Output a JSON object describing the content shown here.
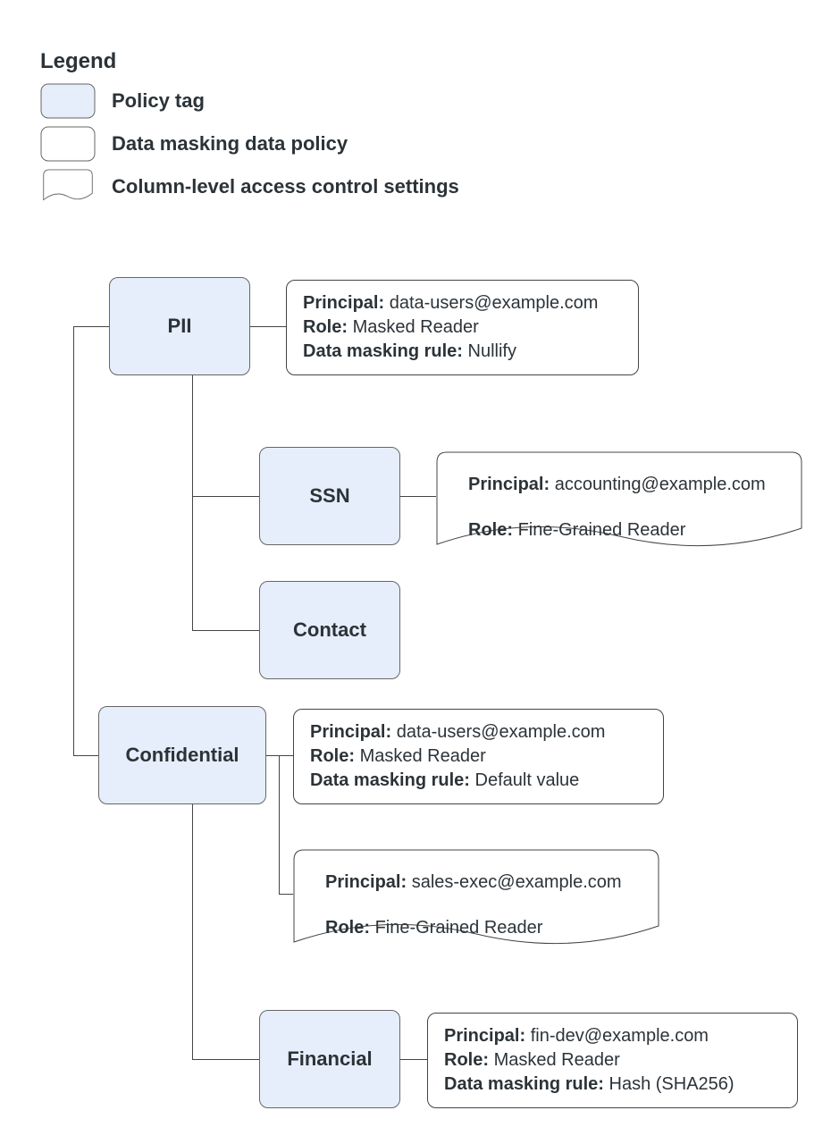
{
  "legend": {
    "title": "Legend",
    "items": [
      {
        "label": "Policy tag"
      },
      {
        "label": "Data masking data policy"
      },
      {
        "label": "Column-level access control settings"
      }
    ]
  },
  "nodes": {
    "pii": {
      "label": "PII",
      "policy": {
        "principal_k": "Principal:",
        "principal_v": "data-users@example.com",
        "role_k": "Role:",
        "role_v": "Masked Reader",
        "rule_k": "Data masking rule:",
        "rule_v": "Nullify"
      }
    },
    "ssn": {
      "label": "SSN",
      "access": {
        "principal_k": "Principal:",
        "principal_v": "accounting@example.com",
        "role_k": "Role:",
        "role_v": "Fine-Grained Reader"
      }
    },
    "contact": {
      "label": "Contact"
    },
    "confidential": {
      "label": "Confidential",
      "policy": {
        "principal_k": "Principal:",
        "principal_v": "data-users@example.com",
        "role_k": "Role:",
        "role_v": "Masked Reader",
        "rule_k": "Data masking rule:",
        "rule_v": "Default value"
      },
      "access": {
        "principal_k": "Principal:",
        "principal_v": "sales-exec@example.com",
        "role_k": "Role:",
        "role_v": "Fine-Grained Reader"
      }
    },
    "financial": {
      "label": "Financial",
      "policy": {
        "principal_k": "Principal:",
        "principal_v": "fin-dev@example.com",
        "role_k": "Role:",
        "role_v": "Masked Reader",
        "rule_k": "Data masking rule:",
        "rule_v": "Hash (SHA256)"
      }
    }
  }
}
